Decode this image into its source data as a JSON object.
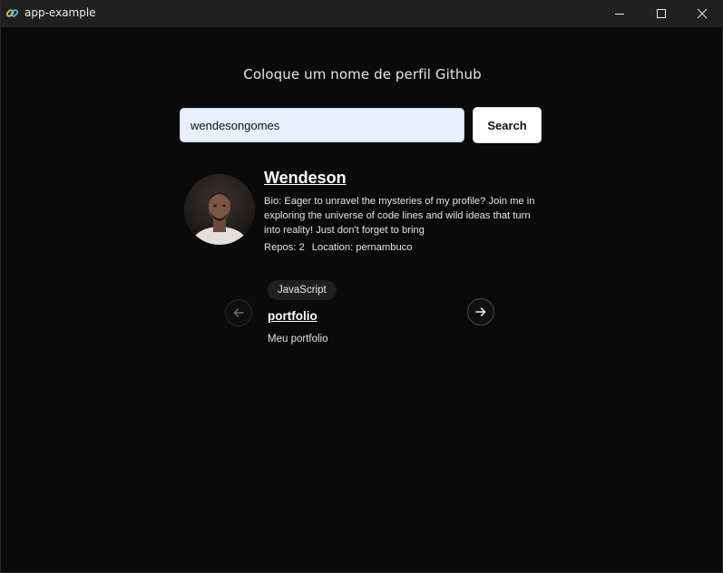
{
  "window": {
    "title": "app-example",
    "icon": "link-chain-icon",
    "controls": [
      "minimize-icon",
      "maximize-icon",
      "close-icon"
    ]
  },
  "search": {
    "prompt": "Coloque um nome de perfil Github",
    "value": "wendesongomes",
    "button_label": "Search"
  },
  "profile": {
    "name": "Wendeson",
    "bio": "Bio: Eager to unravel the mysteries of my profile? Join me in exploring the universe of code lines and wild ideas that turn into reality! Just don't forget to bring",
    "repos": "Repos: 2",
    "location": "Location: pernambuco"
  },
  "repo_carousel": {
    "prev_icon": "arrow-left-icon",
    "next_icon": "arrow-right-icon",
    "language": "JavaScript",
    "name": "portfolio",
    "description": "Meu portfolio"
  },
  "colors": {
    "background": "#0a0a0b",
    "titlebar": "#202020",
    "input_bg": "#e8f0fe",
    "button_bg": "#ffffff",
    "badge_bg": "#1f1f21"
  }
}
